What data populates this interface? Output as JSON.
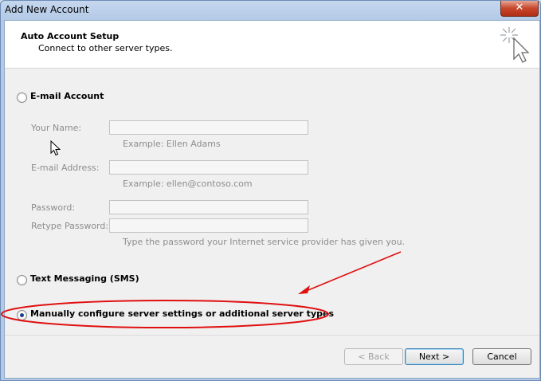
{
  "window": {
    "title": "Add New Account",
    "close_glyph": "✕"
  },
  "header": {
    "title": "Auto Account Setup",
    "subtitle": "Connect to other server types.",
    "icon": "wizard-cursor-icon"
  },
  "options": {
    "email": "E-mail Account",
    "sms": "Text Messaging (SMS)",
    "manual": "Manually configure server settings or additional server types",
    "selected": "manual"
  },
  "email_form": {
    "name_label": "Your Name:",
    "name_value": "",
    "name_hint": "Example: Ellen Adams",
    "email_label": "E-mail Address:",
    "email_value": "",
    "email_hint": "Example: ellen@contoso.com",
    "password_label": "Password:",
    "password_value": "",
    "retype_label": "Retype Password:",
    "retype_value": "",
    "password_hint": "Type the password your Internet service provider has given you."
  },
  "buttons": {
    "back": "< Back",
    "next": "Next >",
    "cancel": "Cancel"
  },
  "colors": {
    "annotation": "#e01010",
    "accent": "#1a3f8c"
  }
}
